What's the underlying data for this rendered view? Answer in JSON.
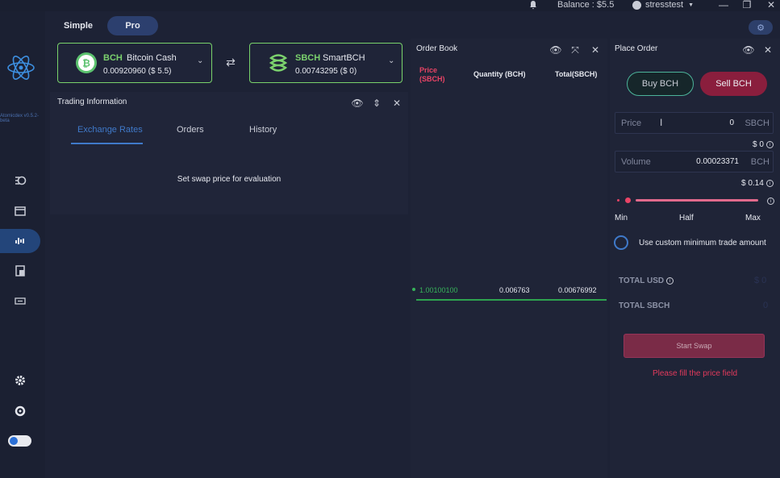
{
  "titlebar": {
    "balance": "Balance : $5.5",
    "user": "stresstest",
    "colors": {
      "bg": "#1a1f30"
    }
  },
  "sidebar": {
    "version": "Atomicdex v0.5.2-beta",
    "icons": [
      "dashboard-icon",
      "wallet-icon",
      "exchange-icon",
      "addressbook-icon",
      "fiat-icon",
      "settings-icon",
      "support-icon"
    ],
    "accent": "#23457a"
  },
  "mode_tabs": {
    "simple": "Simple",
    "pro": "Pro"
  },
  "coin_left": {
    "ticker": "BCH",
    "name": "Bitcoin Cash",
    "price": "0.00920960  ($ 5.5)"
  },
  "coin_right": {
    "ticker": "SBCH",
    "name": "SmartBCH",
    "price": "0.00743295  ($ 0)"
  },
  "trading_info": {
    "title": "Trading Information",
    "tabs": [
      "Exchange Rates",
      "Orders",
      "History"
    ],
    "empty_message": "Set swap price for evaluation"
  },
  "order_book": {
    "title": "Order Book",
    "headers": {
      "price_line1": "Price",
      "price_line2": "(SBCH)",
      "quantity": "Quantity (BCH)",
      "total": "Total(SBCH)"
    },
    "rows": [
      {
        "price": "1.00100100",
        "quantity": "0.006763",
        "total": "0.00676992"
      }
    ]
  },
  "place_order": {
    "title": "Place Order",
    "buy_label": "Buy BCH",
    "sell_label": "Sell BCH",
    "price": {
      "label": "Price",
      "value": "0",
      "unit": "SBCH",
      "usd": "$ 0"
    },
    "volume": {
      "label": "Volume",
      "value": "0.00023371",
      "unit": "BCH",
      "usd": "$ 0.14"
    },
    "slider": {
      "min": "Min",
      "half": "Half",
      "max": "Max"
    },
    "custom_min_label": "Use custom minimum trade amount",
    "total_usd_label": "TOTAL USD",
    "total_usd_value": "$ 0",
    "total_sbch_label": "TOTAL SBCH",
    "total_sbch_value": "0",
    "start_label": "Start Swap",
    "error": "Please fill the price field",
    "colors": {
      "sell": "#8a1e3d",
      "buy_border": "#4cb49a",
      "error": "#e23a5c"
    }
  }
}
